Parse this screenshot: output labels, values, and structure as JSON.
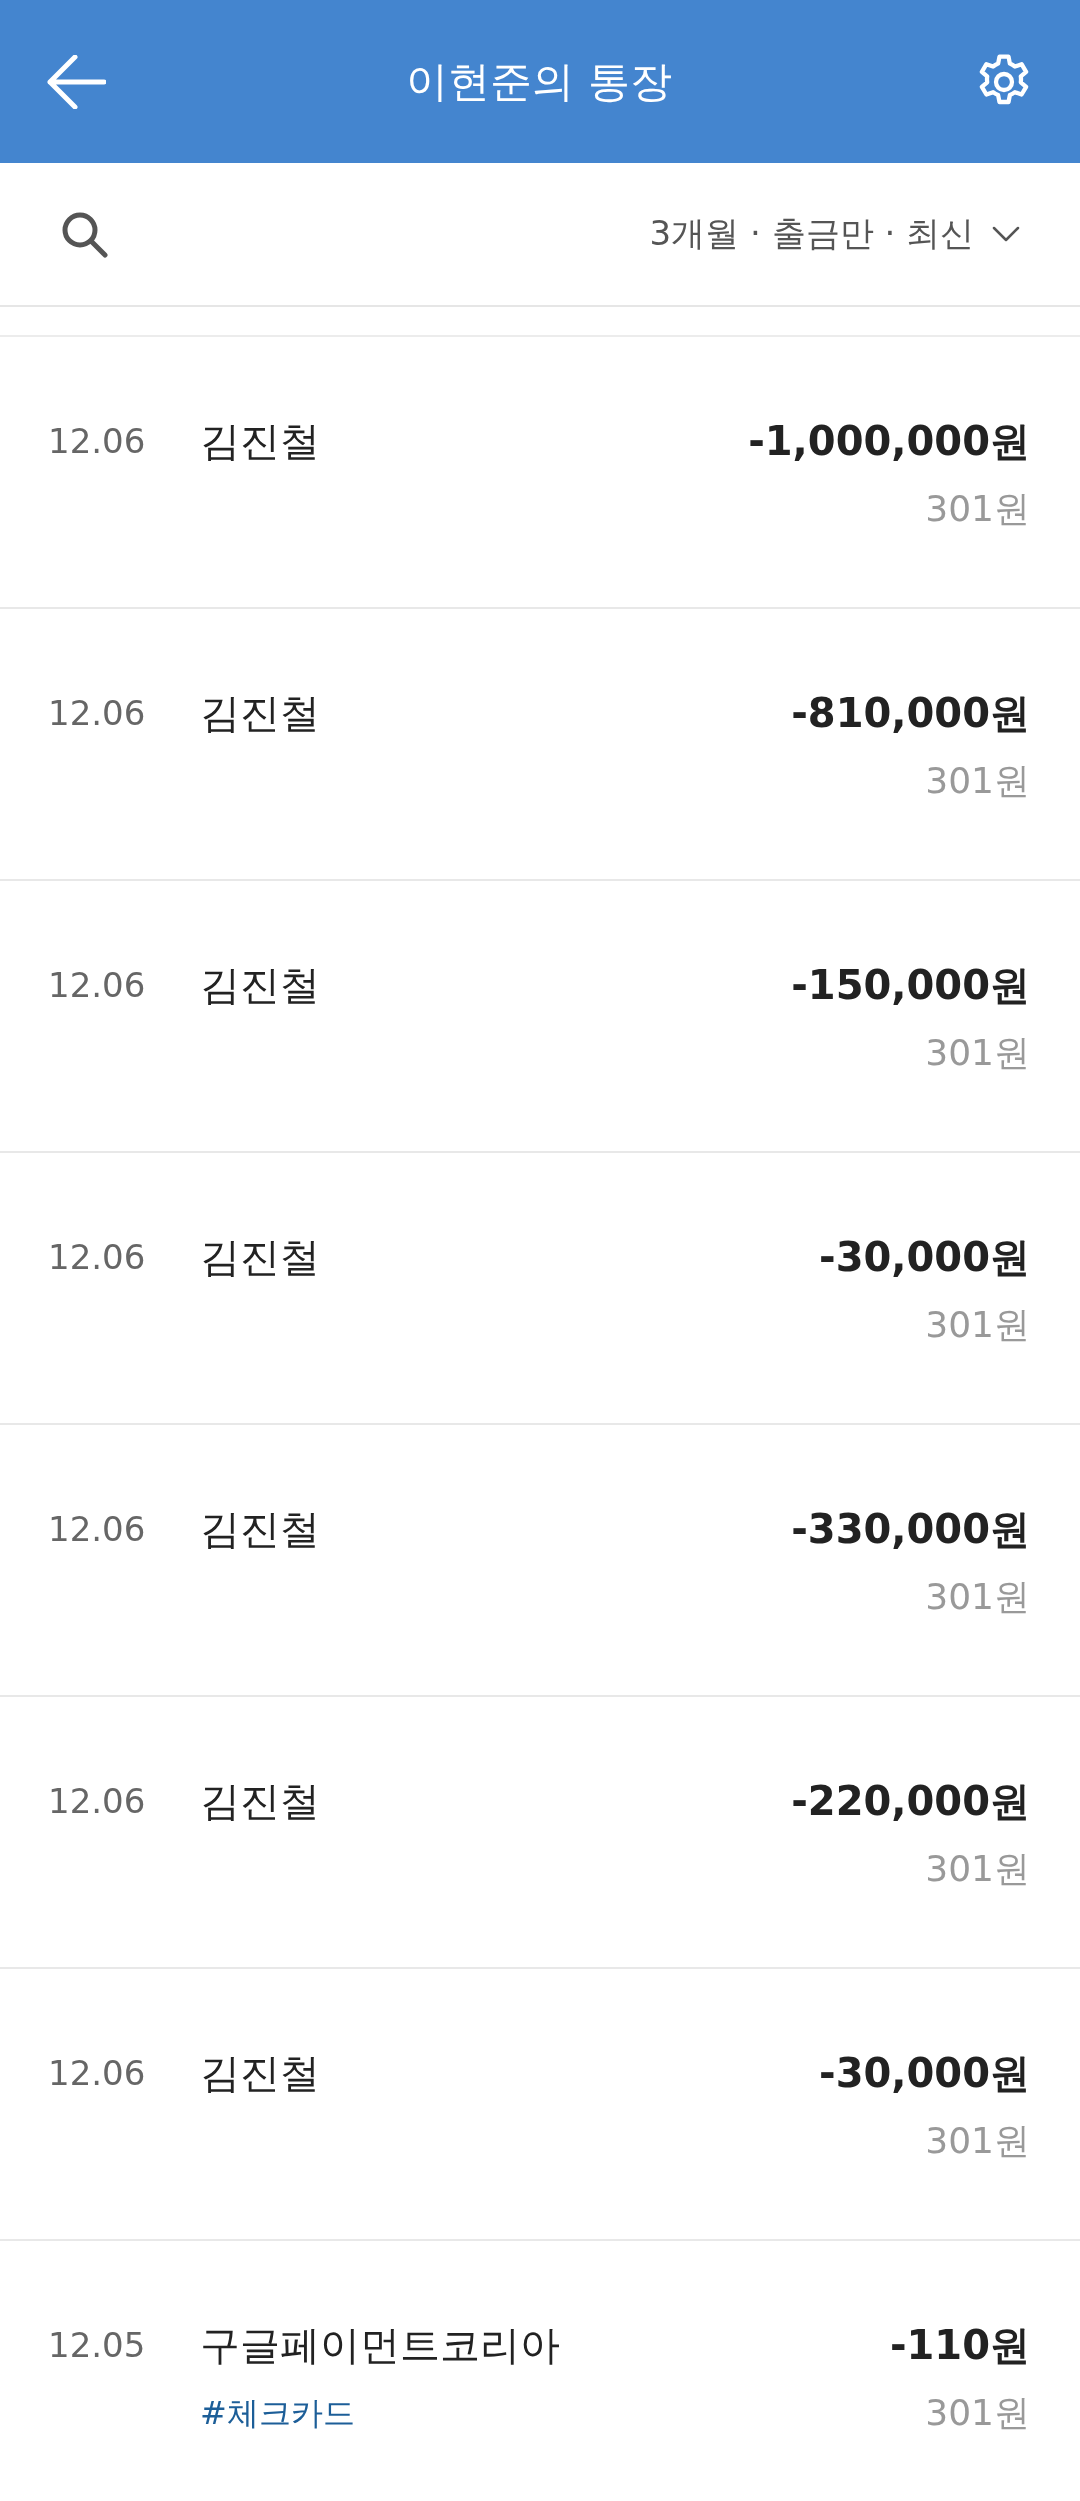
{
  "header": {
    "title": "이현준의 통장"
  },
  "filter_bar": {
    "filter_label": "3개월 · 출금만 · 최신"
  },
  "transactions": [
    {
      "date": "12.06",
      "name": "김진철",
      "amount": "-1,000,000원",
      "balance": "301원"
    },
    {
      "date": "12.06",
      "name": "김진철",
      "amount": "-810,000원",
      "balance": "301원"
    },
    {
      "date": "12.06",
      "name": "김진철",
      "amount": "-150,000원",
      "balance": "301원"
    },
    {
      "date": "12.06",
      "name": "김진철",
      "amount": "-30,000원",
      "balance": "301원"
    },
    {
      "date": "12.06",
      "name": "김진철",
      "amount": "-330,000원",
      "balance": "301원"
    },
    {
      "date": "12.06",
      "name": "김진철",
      "amount": "-220,000원",
      "balance": "301원"
    },
    {
      "date": "12.06",
      "name": "김진철",
      "amount": "-30,000원",
      "balance": "301원"
    },
    {
      "date": "12.05",
      "name": "구글페이먼트코리아",
      "tag": "#체크카드",
      "amount": "-110원",
      "balance": "301원"
    }
  ]
}
